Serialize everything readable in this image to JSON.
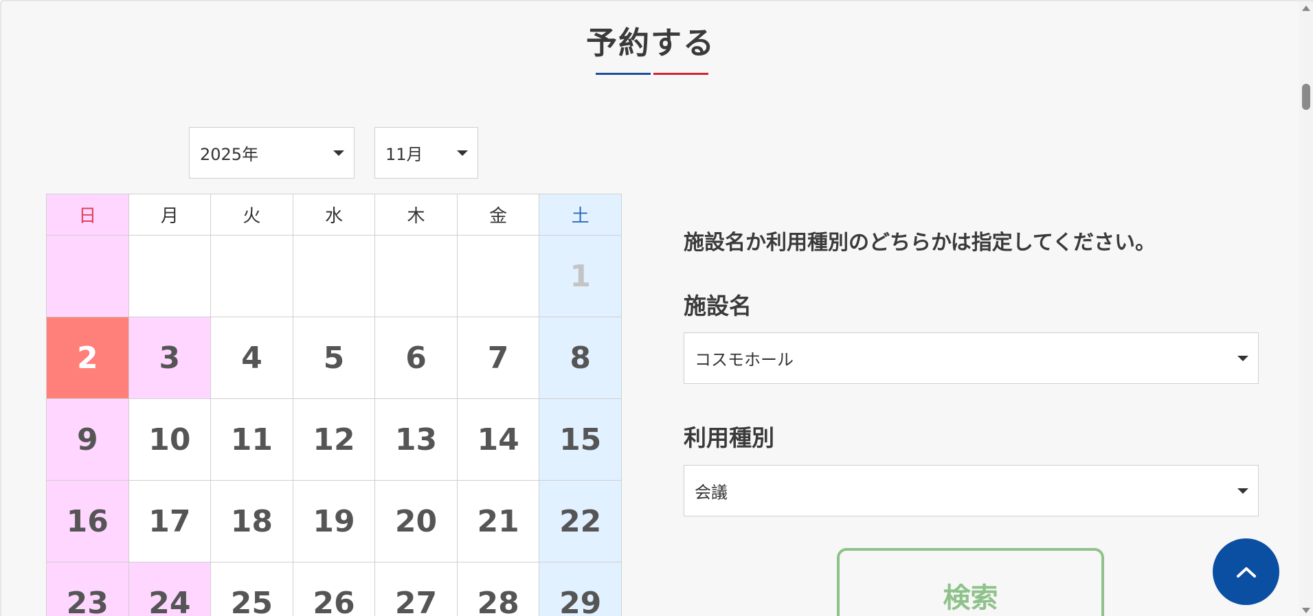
{
  "page": {
    "title": "予約する"
  },
  "date_selectors": {
    "year": "2025年",
    "month": "11月"
  },
  "calendar": {
    "weekdays": [
      "日",
      "月",
      "火",
      "水",
      "木",
      "金",
      "土"
    ],
    "weeks": [
      [
        "",
        "",
        "",
        "",
        "",
        "",
        "1"
      ],
      [
        "2",
        "3",
        "4",
        "5",
        "6",
        "7",
        "8"
      ],
      [
        "9",
        "10",
        "11",
        "12",
        "13",
        "14",
        "15"
      ],
      [
        "16",
        "17",
        "18",
        "19",
        "20",
        "21",
        "22"
      ],
      [
        "23",
        "24",
        "25",
        "26",
        "27",
        "28",
        "29"
      ]
    ],
    "selected_date": "2",
    "holidays": [
      "3",
      "24"
    ]
  },
  "search_form": {
    "note": "施設名か利用種別のどちらかは指定してください。",
    "facility_label": "施設名",
    "facility_value": "コスモホール",
    "usage_label": "利用種別",
    "usage_value": "会議",
    "search_label": "検索"
  },
  "colors": {
    "accent_blue": "#1d4e9b",
    "accent_red": "#d7222e",
    "selected_day": "#ff7f7a",
    "sunday_bg": "#ffd6ff",
    "saturday_bg": "#e2f1ff",
    "search_green": "#8fc28a",
    "to_top_bg": "#0b4fa2"
  },
  "icons": {
    "to_top": "chevron-up-icon",
    "dropdown": "caret-down-icon"
  }
}
